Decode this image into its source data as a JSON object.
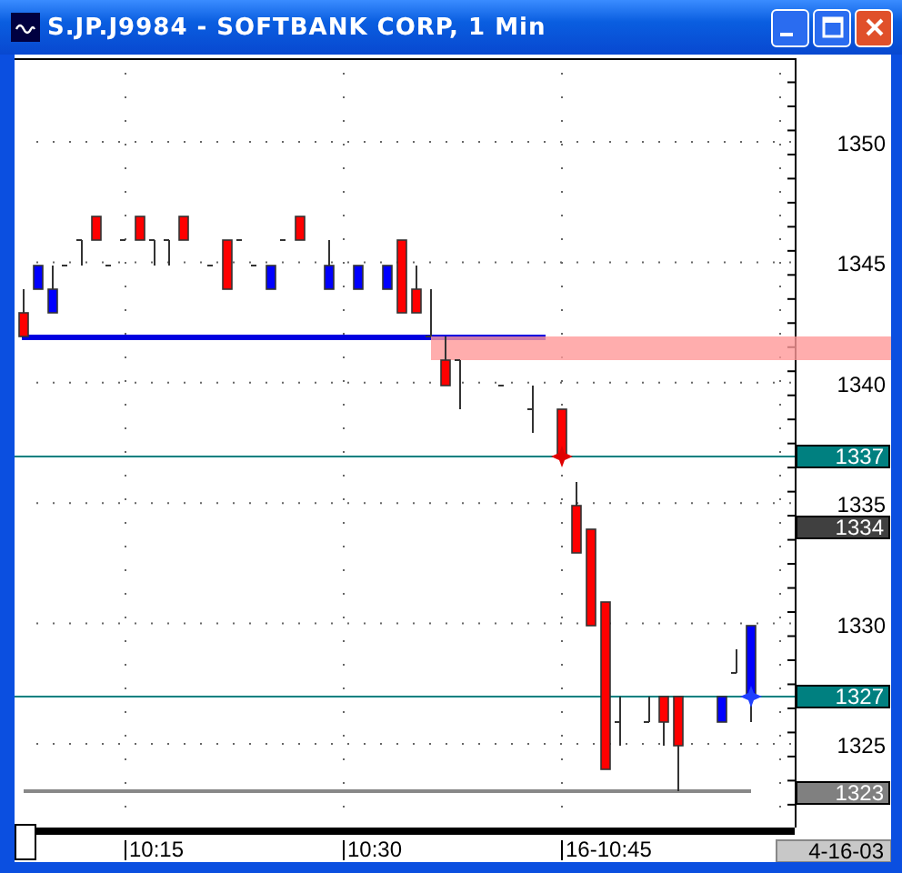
{
  "window": {
    "title": "S.JP.J9984 - SOFTBANK CORP, 1 Min"
  },
  "price_axis": [
    "1350",
    "1345",
    "1340",
    "1335",
    "1330",
    "1325"
  ],
  "price_tags": [
    {
      "label": "1337",
      "color": "#008080"
    },
    {
      "label": "1334",
      "color": "#404040"
    },
    {
      "label": "1327",
      "color": "#008080"
    },
    {
      "label": "1323",
      "color": "#808080"
    }
  ],
  "time_axis": [
    "10:15",
    "10:30",
    "16-10:45"
  ],
  "date": "4-16-03"
}
